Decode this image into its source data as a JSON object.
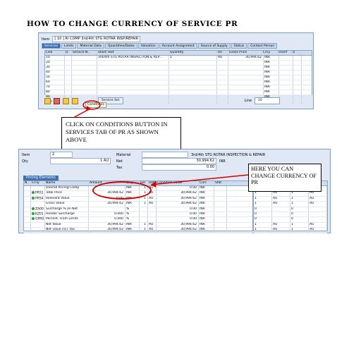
{
  "title": "HOW TO CHANGE CURRENCY OF SERVICE PR",
  "screen1": {
    "item_label": "Item",
    "item_value": "[ 10 ] RI COMP 3rd/4th STG ROTAR INSP/REPAIR",
    "tabs": [
      "Services",
      "Limits",
      "Material Data",
      "Quantities/Dates",
      "Valuation",
      "Account Assignment",
      "Source of Supply",
      "Status",
      "Contact Person"
    ],
    "grid_headers": [
      "Line",
      "D",
      "Service N..",
      "Short Text",
      "Quantity",
      "Un",
      "Gross Price",
      "Crcy",
      "Overf",
      "U"
    ],
    "rows": [
      {
        "line": "10",
        "short_text": "3rd/4th STG ROTAR INSPECTION & REP...",
        "qty": "1",
        "un": "AU",
        "price": "30,994.62",
        "crcy": "INR"
      },
      {
        "line": "20",
        "short_text": "",
        "qty": "",
        "un": "",
        "price": "",
        "crcy": "INR"
      },
      {
        "line": "30",
        "short_text": "",
        "qty": "",
        "un": "",
        "price": "",
        "crcy": "INR"
      },
      {
        "line": "40",
        "short_text": "",
        "qty": "",
        "un": "",
        "price": "",
        "crcy": "INR"
      },
      {
        "line": "50",
        "short_text": "",
        "qty": "",
        "un": "",
        "price": "",
        "crcy": "INR"
      },
      {
        "line": "60",
        "short_text": "",
        "qty": "",
        "un": "",
        "price": "",
        "crcy": "INR"
      },
      {
        "line": "70",
        "short_text": "",
        "qty": "",
        "un": "",
        "price": "",
        "crcy": "INR"
      },
      {
        "line": "80",
        "short_text": "",
        "qty": "",
        "un": "",
        "price": "",
        "crcy": "INR"
      },
      {
        "line": "90",
        "short_text": "",
        "qty": "",
        "un": "",
        "price": "",
        "crcy": "INR"
      },
      {
        "line": "100",
        "short_text": "",
        "qty": "",
        "un": "",
        "price": "",
        "crcy": "INR"
      }
    ],
    "service_sel_label": "Service Sel.",
    "line_label": "Line",
    "line_value": "10",
    "tooltip": "Conditions"
  },
  "callout1": "CLICK ON CONDITIONS BUTTON IN SERVICES TAB OF PR AS SHOWN ABOVE",
  "screen2": {
    "item_label": "Item",
    "item_value": "2",
    "qty_label": "Qty",
    "qty_value": "1 AU",
    "material_label": "Material",
    "material_value": "3rd/4th STG ROTAR INSPECTION & REPAIR",
    "net_label": "Net",
    "net_value": "30,994.62",
    "net_crcy": "INR",
    "tax_label": "Tax",
    "tax_value": "0.00",
    "section_label": "Pricing Elements",
    "grid_headers": [
      "N..",
      "CnTy",
      "Name",
      "Amount",
      "Crcy",
      "per",
      "UoM",
      "Condition value",
      "Curr.",
      "Stat"
    ],
    "rows": [
      {
        "cnty": "",
        "name": "Overall Pricing Comp",
        "amount": "",
        "crcy": "INR",
        "per": "1",
        "uom": "AU",
        "value": "0.00",
        "curr": "INR",
        "dot": false
      },
      {
        "cnty": "PRS1",
        "name": "Total Price",
        "amount": "30,994.62",
        "crcy": "INR",
        "per": "1",
        "uom": "AU",
        "value": "30,994.62",
        "curr": "INR",
        "dot": true
      },
      {
        "cnty": "PRS4",
        "name": "Relevant Value",
        "amount": "0.00",
        "crcy": "INR",
        "per": "1",
        "uom": "AU",
        "value": "30,994.62",
        "curr": "INR",
        "dot": true
      },
      {
        "cnty": "",
        "name": "Gross Value",
        "amount": "30,994.62",
        "crcy": "INR",
        "per": "1",
        "uom": "AU",
        "value": "30,994.62",
        "curr": "INR",
        "dot": false
      },
      {
        "cnty": "ZA00",
        "name": "Surcharge % on Net",
        "amount": "",
        "crcy": "%",
        "per": "",
        "uom": "",
        "value": "0.00",
        "curr": "INR",
        "dot": true
      },
      {
        "cnty": "KZ01",
        "name": "Header Surcharge",
        "amount": "0.000",
        "crcy": "%",
        "per": "",
        "uom": "",
        "value": "0.00",
        "curr": "INR",
        "dot": true
      },
      {
        "cnty": "GPR0",
        "name": "Percent. From Limits",
        "amount": "0.000",
        "crcy": "%",
        "per": "",
        "uom": "",
        "value": "0.00",
        "curr": "INR",
        "dot": true
      },
      {
        "cnty": "",
        "name": "Net Value",
        "amount": "30,994.62",
        "crcy": "INR",
        "per": "1",
        "uom": "AU",
        "value": "30,994.62",
        "curr": "INR",
        "dot": false
      },
      {
        "cnty": "",
        "name": "Net value incl. tax",
        "amount": "30,994.62",
        "crcy": "INR",
        "per": "1",
        "uom": "AU",
        "value": "30,994.62",
        "curr": "INR",
        "dot": false
      }
    ],
    "right_rows": [
      [
        "1",
        "AU",
        "1",
        "AU"
      ],
      [
        "1",
        "AU",
        "1",
        "AU"
      ],
      [
        "1",
        "AU",
        "1",
        "AU"
      ],
      [
        "1",
        "AU",
        "1",
        "AU"
      ],
      [
        "0",
        "",
        "0",
        ""
      ],
      [
        "0",
        "",
        "0",
        ""
      ],
      [
        "0",
        "",
        "0",
        ""
      ],
      [
        "1",
        "AU",
        "1",
        "AU"
      ],
      [
        "1",
        "AU",
        "1",
        "AU"
      ]
    ]
  },
  "callout2": "HERE YOU CAN CHANGE CURRENCY OF PR",
  "colors": {
    "sap_panel": "#dfe8f4",
    "sap_header": "#cfdcee",
    "tab_active": "#3f6fb5",
    "highlight": "#d40000"
  }
}
